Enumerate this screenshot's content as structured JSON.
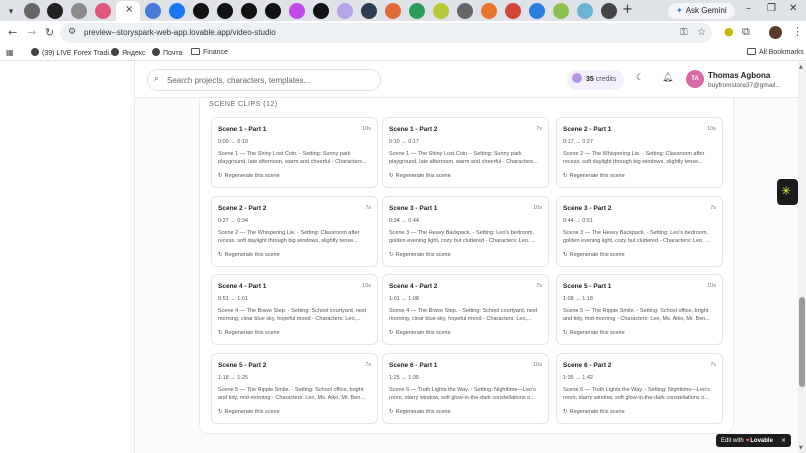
{
  "browser": {
    "tab_close": "×",
    "new_tab": "+",
    "ask_gemini": "Ask Gemini",
    "url": "preview--storyspark-web-app.lovable.app/video-studio",
    "tab_icon_colors": [
      "#666",
      "#222",
      "#8b8b8b",
      "#e0587c",
      "#4a7bd8",
      "#1877f2",
      "#111",
      "#111",
      "#111",
      "#111",
      "#c04ae8",
      "#111",
      "#b6a3e8",
      "#2c3e50",
      "#e06a3a",
      "#2e9b5a",
      "#b5c93a",
      "#666",
      "#e8742c",
      "#d44638",
      "#2a7de1",
      "#8cc152",
      "#6fb3d2",
      "#444"
    ],
    "bookmarks": [
      {
        "label": "(39) LIVE Forex Tradi..."
      },
      {
        "label": "Яндекс"
      },
      {
        "label": "Почта"
      },
      {
        "label": "Finance"
      }
    ],
    "all_bookmarks": "All Bookmarks"
  },
  "header": {
    "search_placeholder": "Search projects, characters, templates...",
    "credits_count": "35",
    "credits_label": "credits",
    "avatar_initials": "TA",
    "user_name": "Thomas Agbona",
    "user_email": "buyfromstore37@gmail..."
  },
  "section": {
    "title": "SCENE CLIPS (12)"
  },
  "regenerate_label": "Regenerate this scene",
  "clips": [
    {
      "title": "Scene 1 - Part 1",
      "duration": "10s",
      "time": "0:00 → 0:10",
      "desc": "Scene 1 — The Shiny Lost Coin. - Setting: Sunny park playground, late afternoon, warm and cheerful - Characters..."
    },
    {
      "title": "Scene 1 - Part 2",
      "duration": "7s",
      "time": "0:10 → 0:17",
      "desc": "Scene 1 — The Shiny Lost Coin. - Setting: Sunny park playground, late afternoon, warm and cheerful - Characters..."
    },
    {
      "title": "Scene 2 - Part 1",
      "duration": "10s",
      "time": "0:17 → 0:27",
      "desc": "Scene 2 — The Whispering Lie. - Setting: Classroom after recess, soft daylight through big windows, slightly tense..."
    },
    {
      "title": "Scene 2 - Part 2",
      "duration": "7s",
      "time": "0:27 → 0:34",
      "desc": "Scene 2 — The Whispering Lie. - Setting: Classroom after recess, soft daylight through big windows, slightly tense..."
    },
    {
      "title": "Scene 3 - Part 1",
      "duration": "10s",
      "time": "0:34 → 0:44",
      "desc": "Scene 3 — The Heavy Backpack. - Setting: Leo's bedroom, golden evening light, cozy but cluttered - Characters: Leo, ..."
    },
    {
      "title": "Scene 3 - Part 2",
      "duration": "7s",
      "time": "0:44 → 0:51",
      "desc": "Scene 3 — The Heavy Backpack. - Setting: Leo's bedroom, golden evening light, cozy but cluttered - Characters: Leo, ..."
    },
    {
      "title": "Scene 4 - Part 1",
      "duration": "10s",
      "time": "0:51 → 1:01",
      "desc": "Scene 4 — The Brave Step. - Setting: School courtyard, next morning, clear blue sky, hopeful mood - Characters: Leo,..."
    },
    {
      "title": "Scene 4 - Part 2",
      "duration": "7s",
      "time": "1:01 → 1:08",
      "desc": "Scene 4 — The Brave Step. - Setting: School courtyard, next morning, clear blue sky, hopeful mood - Characters: Leo,..."
    },
    {
      "title": "Scene 5 - Part 1",
      "duration": "10s",
      "time": "1:08 → 1:18",
      "desc": "Scene 5 — The Ripple Smile. - Setting: School office, bright and tidy, mid-morning - Characters: Leo, Ms. Aiko, Mr. Ben..."
    },
    {
      "title": "Scene 5 - Part 2",
      "duration": "7s",
      "time": "1:18 → 1:25",
      "desc": "Scene 5 — The Ripple Smile. - Setting: School office, bright and tidy, mid-morning - Characters: Leo, Ms. Aiko, Mr. Ben..."
    },
    {
      "title": "Scene 6 - Part 1",
      "duration": "10s",
      "time": "1:25 → 1:35",
      "desc": "Scene 6 — Truth Lights the Way. - Setting: Nighttime—Leo's room, starry window, soft glow-in-the-dark constellations o..."
    },
    {
      "title": "Scene 6 - Part 2",
      "duration": "7s",
      "time": "1:35 → 1:42",
      "desc": "Scene 6 — Truth Lights the Way. - Setting: Nighttime—Leo's room, starry window, soft glow-in-the-dark constellations o..."
    }
  ],
  "lovable_badge": {
    "prefix": "Edit with",
    "heart": "♥",
    "brand": "Lovable",
    "close": "×"
  },
  "colors": {
    "accent": "#b792ea",
    "avatar": "#d86aa6",
    "extension": "#d7f03b"
  }
}
